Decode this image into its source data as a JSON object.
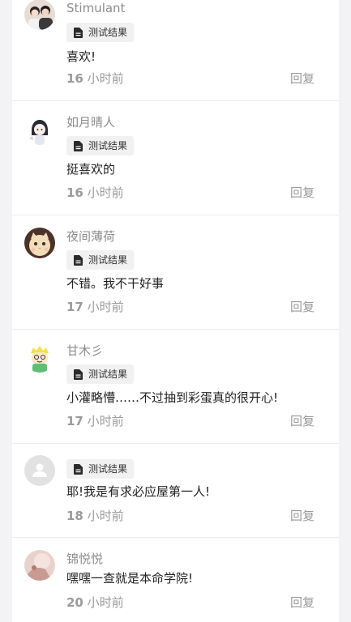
{
  "comments": [
    {
      "username": "Stimulant",
      "tag": "测试结果",
      "text": "喜欢!",
      "time_num": "16",
      "time_unit": " 小时前",
      "reply": "回复",
      "avatar": "photo-couple-avatar"
    },
    {
      "username": "如月晴人",
      "tag": "测试结果",
      "text": "挺喜欢的",
      "time_num": "16",
      "time_unit": " 小时前",
      "reply": "回复",
      "avatar": "anime-girl-avatar"
    },
    {
      "username": "夜间薄荷",
      "tag": "测试结果",
      "text": "不错。我不干好事",
      "time_num": "17",
      "time_unit": " 小时前",
      "reply": "回复",
      "avatar": "cat-avatar"
    },
    {
      "username": "甘木彡",
      "tag": "测试结果",
      "text": "小灌略懵……不过抽到彩蛋真的很开心!",
      "time_num": "17",
      "time_unit": " 小时前",
      "reply": "回复",
      "avatar": "cartoon-character-avatar"
    },
    {
      "username": "",
      "tag": "测试结果",
      "text": "耶!我是有求必应屋第一人!",
      "time_num": "18",
      "time_unit": " 小时前",
      "reply": "回复",
      "avatar": "default-user-avatar"
    },
    {
      "username": "锦悦悦",
      "text": "嘿嘿一查就是本命学院!",
      "time_num": "20",
      "time_unit": " 小时前",
      "reply": "回复",
      "avatar": "photo-avatar"
    }
  ]
}
